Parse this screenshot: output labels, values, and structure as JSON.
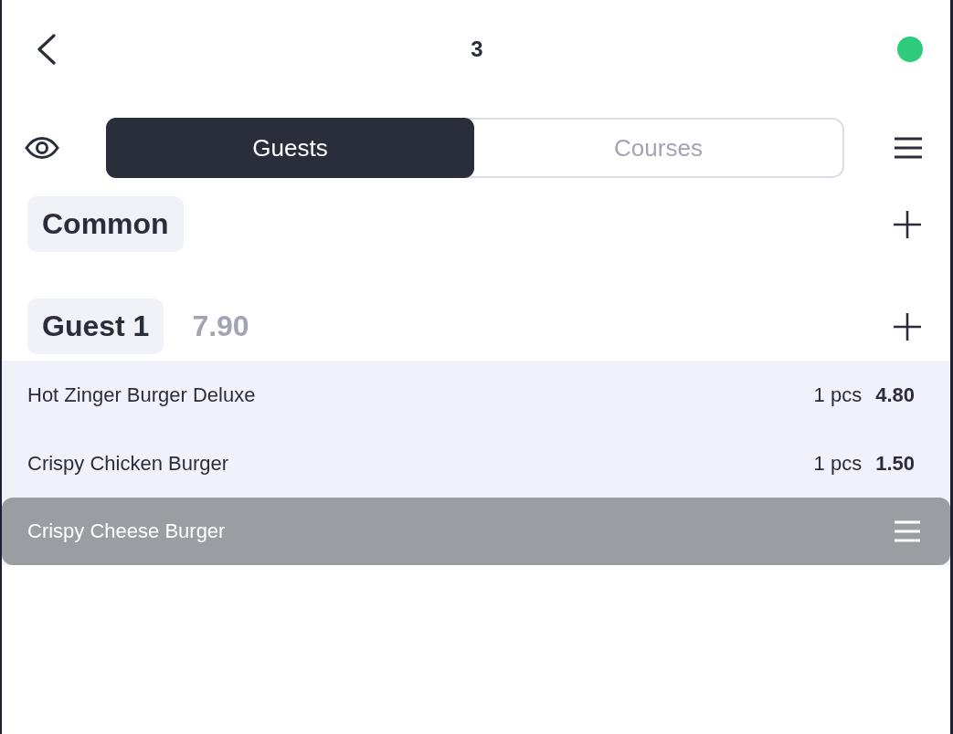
{
  "header": {
    "title": "3",
    "connected": true
  },
  "tabs": [
    {
      "label": "Guests",
      "selected": true
    },
    {
      "label": "Courses",
      "selected": false
    }
  ],
  "groups": [
    {
      "name": "Common"
    },
    {
      "name": "Guest 1",
      "total": "7.90",
      "items": [
        {
          "name": "Hot Zinger Burger Deluxe",
          "quantity": "1 pcs",
          "price": "4.80",
          "dragging": false
        },
        {
          "name": "Crispy Chicken Burger",
          "quantity": "1 pcs",
          "price": "1.50",
          "dragging": false
        },
        {
          "name": "Crispy Cheese Burger",
          "dragging": true
        }
      ]
    }
  ]
}
